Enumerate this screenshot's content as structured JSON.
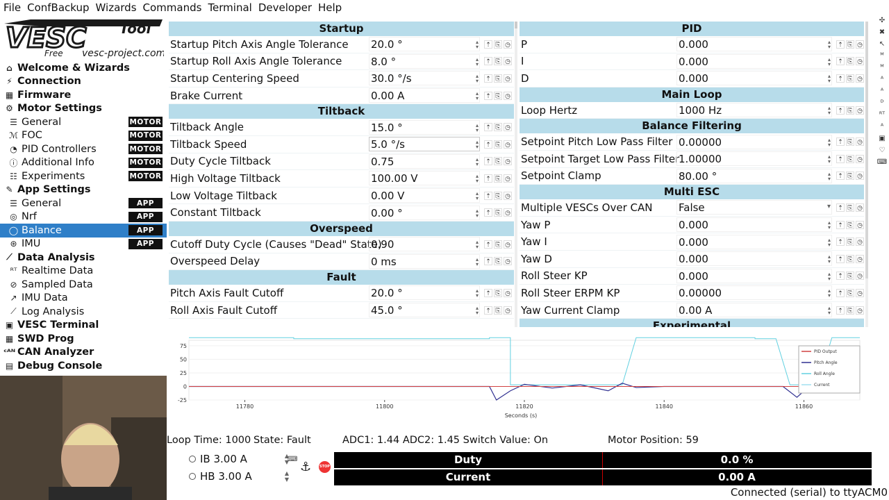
{
  "menu": [
    "File",
    "ConfBackup",
    "Wizards",
    "Commands",
    "Terminal",
    "Developer",
    "Help"
  ],
  "logo": {
    "main": "VESC",
    "tool": "Tool",
    "free": "Free",
    "site": "vesc-project.com"
  },
  "sidebar": [
    {
      "label": "Welcome & Wizards",
      "level": 0,
      "icon": "home-icon",
      "glyph": "⌂"
    },
    {
      "label": "Connection",
      "level": 0,
      "icon": "plug-icon",
      "glyph": "⚡"
    },
    {
      "label": "Firmware",
      "level": 0,
      "icon": "chip-icon",
      "glyph": "▦"
    },
    {
      "label": "Motor Settings",
      "level": 0,
      "icon": "gear-icon",
      "glyph": "⚙"
    },
    {
      "label": "General",
      "level": 1,
      "icon": "sliders-icon",
      "glyph": "☰",
      "badge": "MOTOR"
    },
    {
      "label": "FOC",
      "level": 1,
      "icon": "coil-icon",
      "glyph": "ℳ",
      "badge": "MOTOR"
    },
    {
      "label": "PID Controllers",
      "level": 1,
      "icon": "gauge-icon",
      "glyph": "◔",
      "badge": "MOTOR"
    },
    {
      "label": "Additional Info",
      "level": 1,
      "icon": "info-icon",
      "glyph": "ⓘ",
      "badge": "MOTOR"
    },
    {
      "label": "Experiments",
      "level": 1,
      "icon": "list-icon",
      "glyph": "☷",
      "badge": "MOTOR"
    },
    {
      "label": "App Settings",
      "level": 0,
      "icon": "tools-icon",
      "glyph": "✎"
    },
    {
      "label": "General",
      "level": 1,
      "icon": "sliders-icon",
      "glyph": "☰",
      "badge": "APP"
    },
    {
      "label": "Nrf",
      "level": 1,
      "icon": "wireless-icon",
      "glyph": "◎",
      "badge": "APP"
    },
    {
      "label": "Balance",
      "level": 1,
      "icon": "balance-icon",
      "glyph": "◯",
      "badge": "APP",
      "selected": true
    },
    {
      "label": "IMU",
      "level": 1,
      "icon": "imu-icon",
      "glyph": "⊛",
      "badge": "APP"
    },
    {
      "label": "Data Analysis",
      "level": 0,
      "icon": "chart-icon",
      "glyph": "⟋"
    },
    {
      "label": "Realtime Data",
      "level": 1,
      "icon": "realtime-icon",
      "glyph": "ᴿᵀ"
    },
    {
      "label": "Sampled Data",
      "level": 1,
      "icon": "sampled-icon",
      "glyph": "⊘"
    },
    {
      "label": "IMU Data",
      "level": 1,
      "icon": "imu-data-icon",
      "glyph": "↗"
    },
    {
      "label": "Log Analysis",
      "level": 1,
      "icon": "log-icon",
      "glyph": "⟋"
    },
    {
      "label": "VESC Terminal",
      "level": 0,
      "icon": "terminal-icon",
      "glyph": "▣"
    },
    {
      "label": "SWD Prog",
      "level": 0,
      "icon": "swd-icon",
      "glyph": "▦"
    },
    {
      "label": "CAN Analyzer",
      "level": 0,
      "icon": "can-icon",
      "glyph": "ᶜᴬᴺ"
    },
    {
      "label": "Debug Console",
      "level": 0,
      "icon": "console-icon",
      "glyph": "▤"
    }
  ],
  "left_panel": [
    {
      "section": "Startup"
    },
    {
      "name": "Startup Pitch Axis Angle Tolerance",
      "value": "20.0 °"
    },
    {
      "name": "Startup Roll Axis Angle Tolerance",
      "value": "8.0 °"
    },
    {
      "name": "Startup Centering Speed",
      "value": "30.0 °/s"
    },
    {
      "name": "Brake Current",
      "value": "0.00 A"
    },
    {
      "section": "Tiltback"
    },
    {
      "name": "Tiltback Angle",
      "value": "15.0 °"
    },
    {
      "name": "Tiltback Speed",
      "value": "5.0 °/s",
      "focus": true
    },
    {
      "name": "Duty Cycle Tiltback",
      "value": "0.75"
    },
    {
      "name": "High Voltage Tiltback",
      "value": "100.00 V"
    },
    {
      "name": "Low Voltage Tiltback",
      "value": "0.00 V"
    },
    {
      "name": "Constant Tiltback",
      "value": "0.00 °"
    },
    {
      "section": "Overspeed"
    },
    {
      "name": "Cutoff Duty Cycle (Causes \"Dead\" State)",
      "value": "0.90"
    },
    {
      "name": "Overspeed Delay",
      "value": "0 ms"
    },
    {
      "section": "Fault"
    },
    {
      "name": "Pitch Axis Fault Cutoff",
      "value": "20.0 °"
    },
    {
      "name": "Roll Axis Fault Cutoff",
      "value": "45.0 °"
    }
  ],
  "right_panel": [
    {
      "section": "PID"
    },
    {
      "name": "P",
      "value": "0.000"
    },
    {
      "name": "I",
      "value": "0.000"
    },
    {
      "name": "D",
      "value": "0.000"
    },
    {
      "section": "Main Loop"
    },
    {
      "name": "Loop Hertz",
      "value": "1000 Hz"
    },
    {
      "section": "Balance Filtering"
    },
    {
      "name": "Setpoint Pitch Low Pass Filter",
      "value": "0.00000"
    },
    {
      "name": "Setpoint Target Low Pass Filter",
      "value": "1.00000"
    },
    {
      "name": "Setpoint Clamp",
      "value": "80.00 °"
    },
    {
      "section": "Multi ESC"
    },
    {
      "name": "Multiple VESCs Over CAN",
      "value": "False",
      "dropdown": true
    },
    {
      "name": "Yaw P",
      "value": "0.000"
    },
    {
      "name": "Yaw I",
      "value": "0.000"
    },
    {
      "name": "Yaw D",
      "value": "0.000"
    },
    {
      "name": "Roll Steer KP",
      "value": "0.000"
    },
    {
      "name": "Roll Steer ERPM KP",
      "value": "0.00000"
    },
    {
      "name": "Yaw Current Clamp",
      "value": "0.00 A"
    },
    {
      "section": "Experimental"
    }
  ],
  "chart_data": {
    "type": "line",
    "xlabel": "Seconds (s)",
    "xlim": [
      11772,
      11868
    ],
    "ylim": [
      -25,
      80
    ],
    "x_ticks": [
      11780,
      11800,
      11820,
      11840,
      11860
    ],
    "y_ticks": [
      -25,
      0,
      25,
      50,
      75
    ],
    "legend": [
      "PID Output",
      "Pitch Angle",
      "Roll Angle",
      "Current"
    ],
    "series_colors": {
      "PID Output": "#d04040",
      "Pitch Angle": "#303090",
      "Roll Angle": "#60d0e0",
      "Current": "#a0e0f0"
    },
    "series": [
      {
        "name": "Roll Angle",
        "points": [
          [
            11772,
            90
          ],
          [
            11787,
            90
          ],
          [
            11787,
            88
          ],
          [
            11815,
            88
          ],
          [
            11815,
            90
          ],
          [
            11818,
            90
          ],
          [
            11818,
            3
          ],
          [
            11834,
            3
          ],
          [
            11836,
            90
          ],
          [
            11853,
            90
          ],
          [
            11853,
            88
          ],
          [
            11856,
            88
          ],
          [
            11858,
            3
          ],
          [
            11862,
            3
          ],
          [
            11864,
            90
          ],
          [
            11868,
            90
          ]
        ]
      },
      {
        "name": "Pitch Angle",
        "points": [
          [
            11772,
            0
          ],
          [
            11815,
            0
          ],
          [
            11816,
            -25
          ],
          [
            11818,
            -8
          ],
          [
            11820,
            4
          ],
          [
            11824,
            -3
          ],
          [
            11828,
            3
          ],
          [
            11832,
            -8
          ],
          [
            11834,
            6
          ],
          [
            11836,
            -2
          ],
          [
            11840,
            0
          ],
          [
            11857,
            0
          ],
          [
            11859,
            -20
          ],
          [
            11861,
            3
          ],
          [
            11863,
            -2
          ],
          [
            11868,
            0
          ]
        ]
      },
      {
        "name": "PID Output",
        "points": [
          [
            11772,
            0
          ],
          [
            11868,
            0
          ]
        ]
      }
    ]
  },
  "status": {
    "loop_time": "Loop Time: 1000",
    "state": "State: Fault",
    "adc": "ADC1: 1.44 ADC2: 1.45 Switch Value: On",
    "motor_position": "Motor Position: 59"
  },
  "controls": {
    "ib": "IB 3.00 A",
    "hb": "HB 3.00 A",
    "stop": "STOP"
  },
  "bars": [
    {
      "label": "Duty",
      "value": "0.0 %"
    },
    {
      "label": "Current",
      "value": "0.00 A"
    }
  ],
  "footer": "Connected (serial) to ttyACM0"
}
